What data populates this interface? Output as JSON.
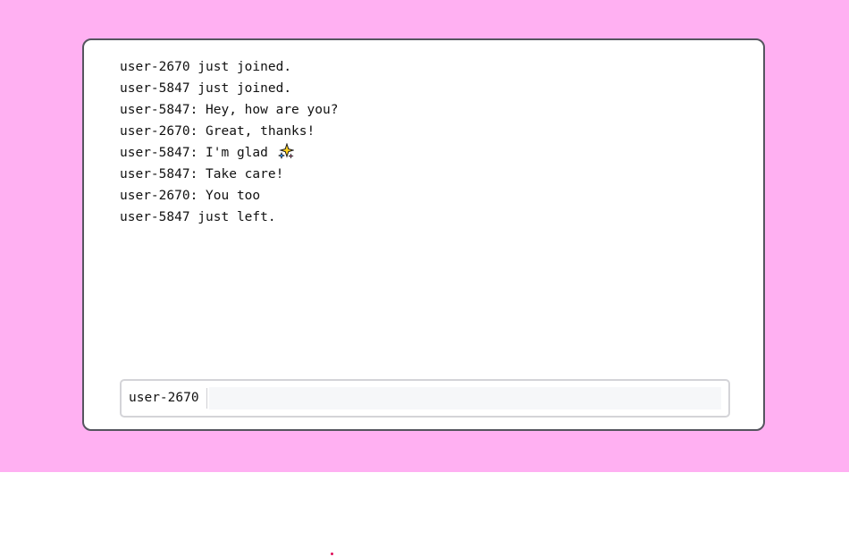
{
  "colors": {
    "page_background": "#ffb0f2",
    "cursor": "#e0105a"
  },
  "chat": {
    "messages": [
      {
        "text": "user-2670 just joined."
      },
      {
        "text": "user-5847 just joined."
      },
      {
        "text": "user-5847: Hey, how are you?"
      },
      {
        "text": "user-2670: Great, thanks!"
      },
      {
        "text": "user-5847: I'm glad",
        "emoji": "sparkles-icon"
      },
      {
        "text": "user-5847: Take care!"
      },
      {
        "text": "user-2670: You too"
      },
      {
        "text": "user-5847 just left."
      }
    ]
  },
  "composer": {
    "username": "user-2670",
    "input_value": ""
  }
}
